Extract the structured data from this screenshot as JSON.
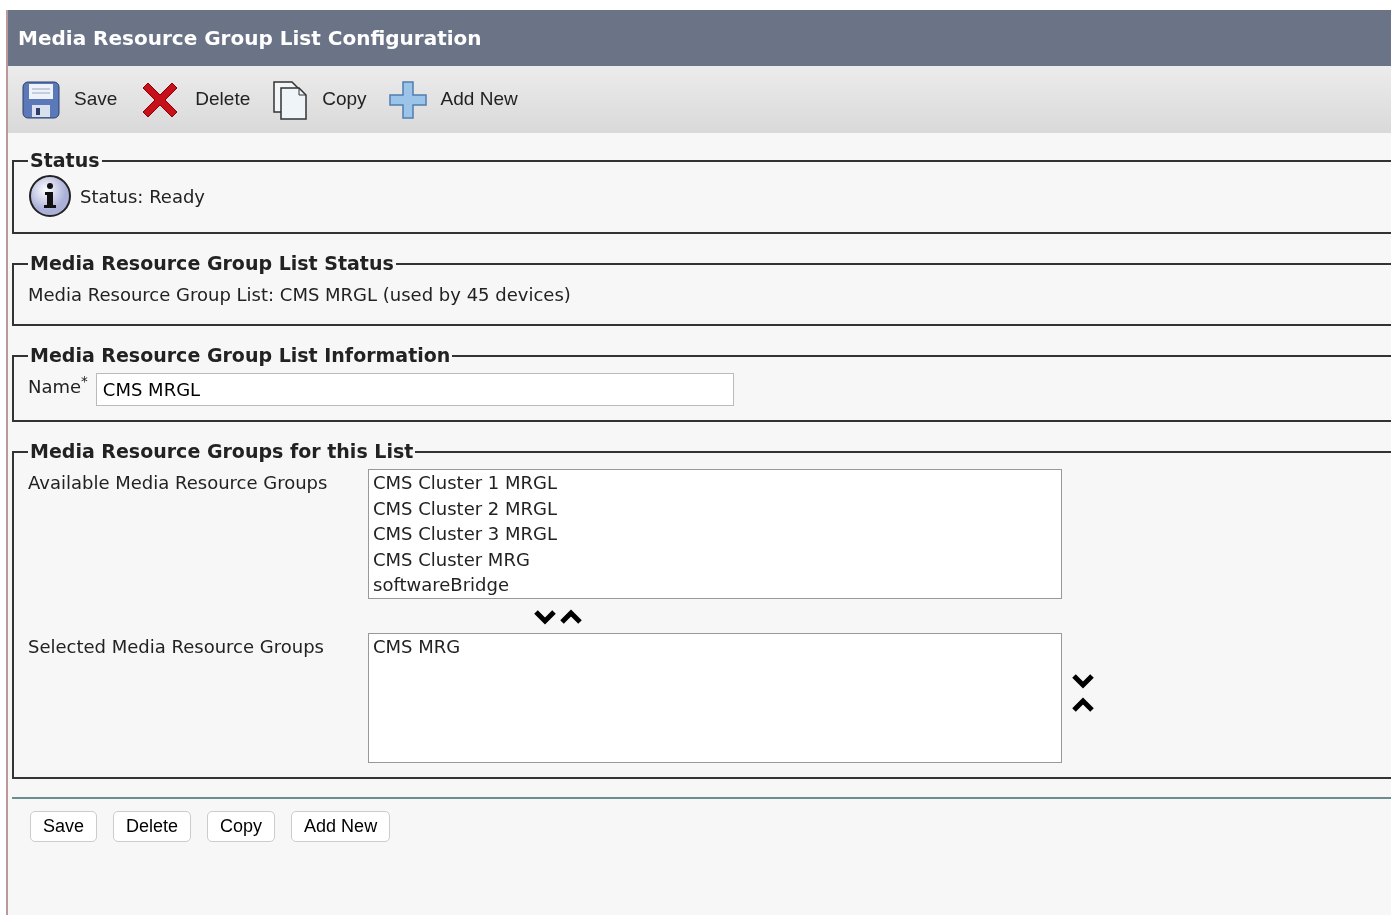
{
  "page_title": "Media Resource Group List Configuration",
  "toolbar": [
    {
      "kind": "save",
      "label": "Save"
    },
    {
      "kind": "delete",
      "label": "Delete"
    },
    {
      "kind": "copy",
      "label": "Copy"
    },
    {
      "kind": "add",
      "label": "Add New"
    }
  ],
  "status": {
    "legend": "Status",
    "message": "Status: Ready"
  },
  "list_status": {
    "legend": "Media Resource Group List Status",
    "text": "Media Resource Group List: CMS MRGL (used by 45 devices)"
  },
  "information": {
    "legend": "Media Resource Group List Information",
    "name_label": "Name",
    "required_mark": "*",
    "name_value": "CMS MRGL"
  },
  "groups": {
    "legend": "Media Resource Groups for this List",
    "available_label": "Available Media Resource Groups",
    "available": [
      "CMS Cluster 1 MRGL",
      "CMS Cluster 2 MRGL",
      "CMS Cluster 3 MRGL",
      "CMS Cluster MRG",
      "softwareBridge"
    ],
    "selected_label": "Selected Media Resource Groups",
    "selected": [
      "CMS MRG"
    ]
  },
  "buttons": [
    "Save",
    "Delete",
    "Copy",
    "Add New"
  ]
}
